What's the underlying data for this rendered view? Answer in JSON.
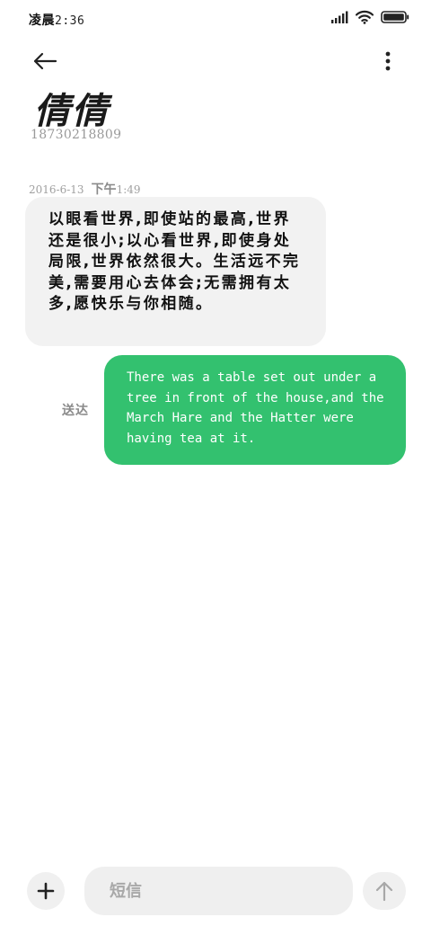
{
  "status_bar": {
    "time_label": "凌晨",
    "time_value": "2:36",
    "icons": [
      "signal-icon",
      "wifi-icon",
      "battery-icon"
    ]
  },
  "header": {
    "back_icon": "arrow-left-icon",
    "more_icon": "more-vertical-icon",
    "contact_name": "倩倩",
    "contact_number": "18730218809"
  },
  "conversation": {
    "timestamp": {
      "date": "2016-6-13",
      "ampm": "下午",
      "time": "1:49"
    },
    "messages": [
      {
        "direction": "incoming",
        "text": "以眼看世界,即使站的最高,世界还是很小;以心看世界,即使身处局限,世界依然很大。生活远不完美,需要用心去体会;无需拥有太多,愿快乐与你相随。"
      },
      {
        "direction": "outgoing",
        "text": "There was a table set out under a tree in front of the house,and the March Hare and the Hatter were having tea at it.",
        "status": "送达"
      }
    ]
  },
  "composer": {
    "add_icon": "plus-icon",
    "placeholder": "短信",
    "send_icon": "arrow-up-icon"
  },
  "colors": {
    "outgoing_bubble": "#33c16f",
    "incoming_bubble": "#f2f2f2",
    "background": "#ffffff"
  }
}
